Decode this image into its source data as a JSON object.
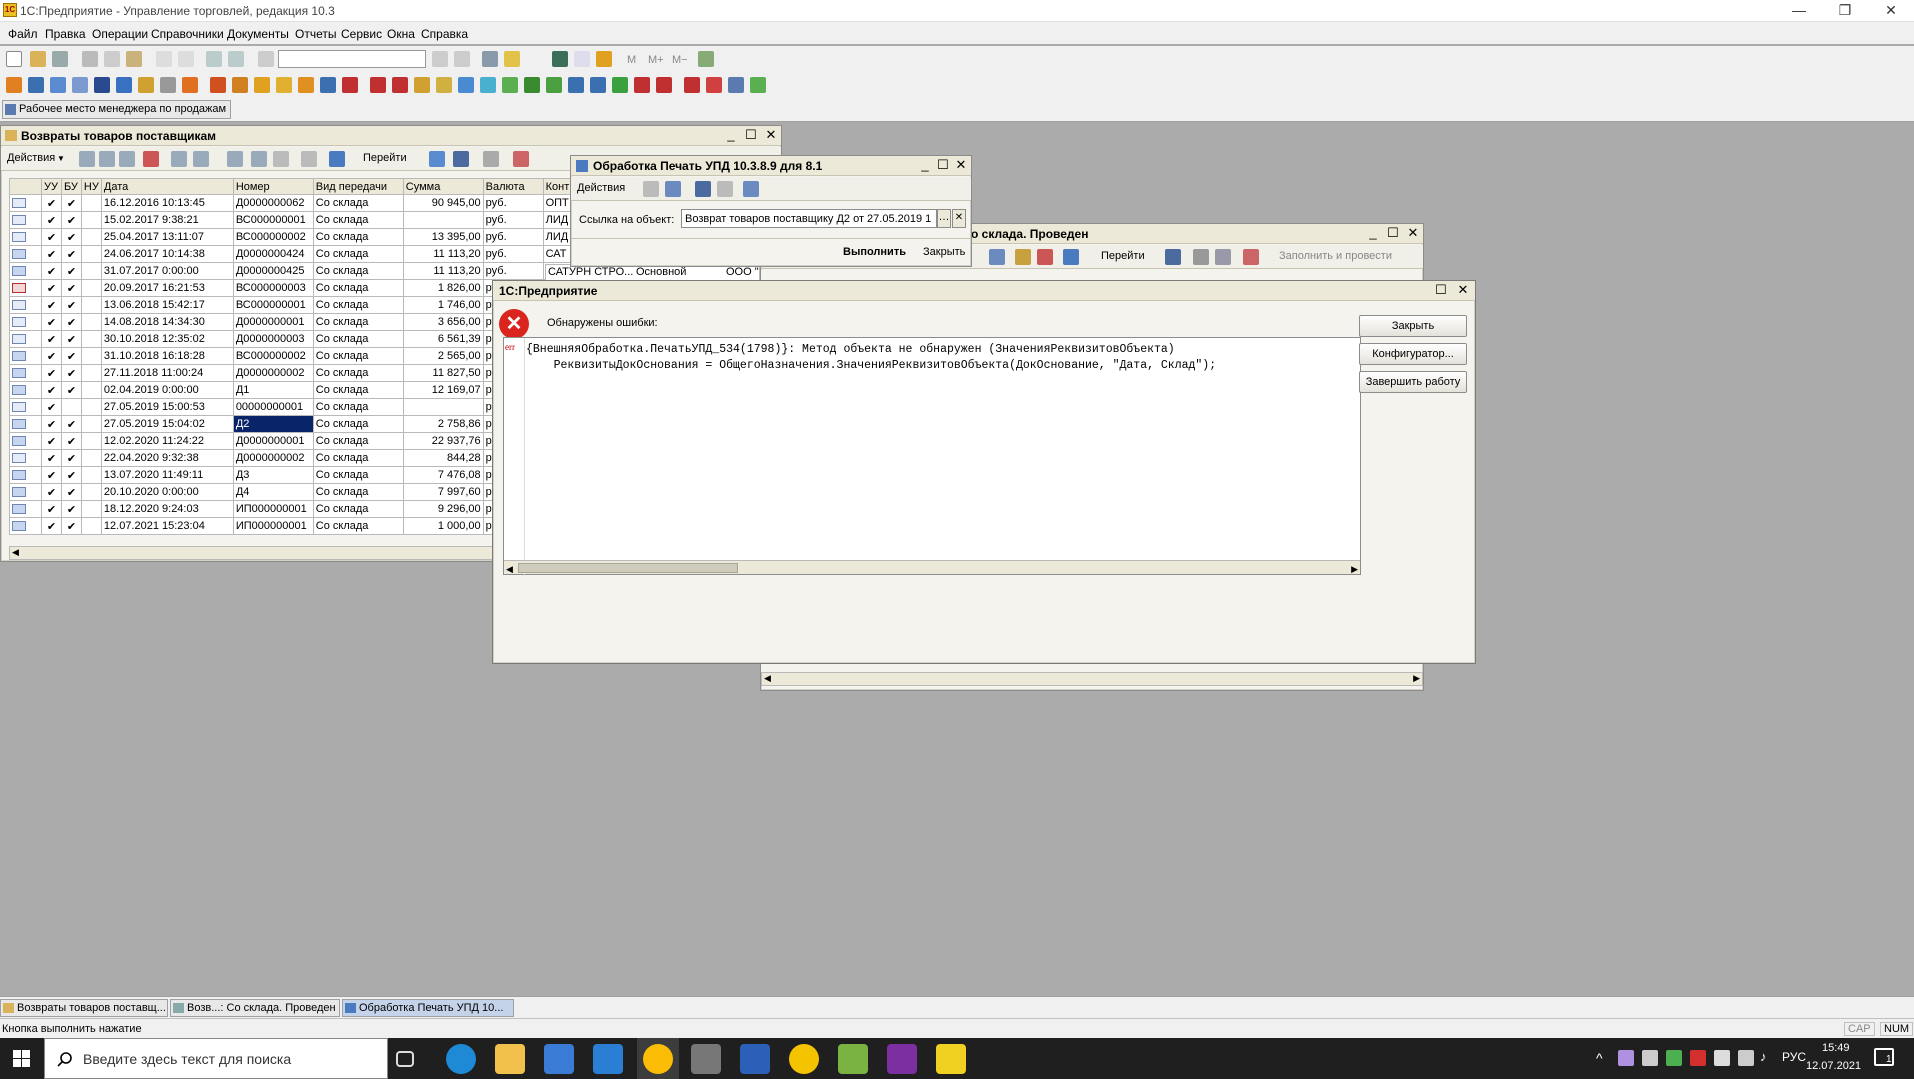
{
  "app": {
    "title": "1С:Предприятие - Управление торговлей, редакция 10.3",
    "icon_label": "1С"
  },
  "window_controls": {
    "minimize": "—",
    "restore": "❐",
    "close": "✕"
  },
  "menu": [
    "Файл",
    "Правка",
    "Операции",
    "Справочники",
    "Документы",
    "Отчеты",
    "Сервис",
    "Окна",
    "Справка"
  ],
  "quickbar": {
    "label": "Рабочее место менеджера по продажам"
  },
  "toolbar_letters": {
    "m": "M",
    "mplus": "M+",
    "mminus": "M−"
  },
  "returns_window": {
    "title": "Возвраты товаров поставщикам",
    "actions_label": "Действия",
    "goto_label": "Перейти",
    "columns": [
      "",
      "УУ",
      "БУ",
      "НУ",
      "Дата",
      "Номер",
      "Вид передачи",
      "Сумма",
      "Валюта",
      "Конт"
    ],
    "rows": [
      {
        "icon": "doc",
        "uu": "✔",
        "bu": "✔",
        "nu": "",
        "date": "16.12.2016 10:13:45",
        "num": "Д0000000062",
        "type": "Со склада",
        "sum": "90 945,00",
        "cur": "руб.",
        "kont": "ОПТ"
      },
      {
        "icon": "doc",
        "uu": "✔",
        "bu": "✔",
        "nu": "",
        "date": "15.02.2017 9:38:21",
        "num": "ВС000000001",
        "type": "Со склада",
        "sum": "",
        "cur": "руб.",
        "kont": "ЛИД"
      },
      {
        "icon": "doc",
        "uu": "✔",
        "bu": "✔",
        "nu": "",
        "date": "25.04.2017 13:11:07",
        "num": "ВС000000002",
        "type": "Со склада",
        "sum": "13 395,00",
        "cur": "руб.",
        "kont": "ЛИД"
      },
      {
        "icon": "blue",
        "uu": "✔",
        "bu": "✔",
        "nu": "",
        "date": "24.06.2017 10:14:38",
        "num": "Д0000000424",
        "type": "Со склада",
        "sum": "11 113,20",
        "cur": "руб.",
        "kont": "САТ"
      },
      {
        "icon": "blue",
        "uu": "✔",
        "bu": "✔",
        "nu": "",
        "date": "31.07.2017 0:00:00",
        "num": "Д0000000425",
        "type": "Со склада",
        "sum": "11 113,20",
        "cur": "руб.",
        "kont": "САТ"
      },
      {
        "icon": "red",
        "uu": "✔",
        "bu": "✔",
        "nu": "",
        "date": "20.09.2017 16:21:53",
        "num": "ВС000000003",
        "type": "Со склада",
        "sum": "1 826,00",
        "cur": "руб.",
        "kont": ""
      },
      {
        "icon": "doc",
        "uu": "✔",
        "bu": "✔",
        "nu": "",
        "date": "13.06.2018 15:42:17",
        "num": "ВС000000001",
        "type": "Со склада",
        "sum": "1 746,00",
        "cur": "руб.",
        "kont": ""
      },
      {
        "icon": "doc",
        "uu": "✔",
        "bu": "✔",
        "nu": "",
        "date": "14.08.2018 14:34:30",
        "num": "Д0000000001",
        "type": "Со склада",
        "sum": "3 656,00",
        "cur": "руб.",
        "kont": ""
      },
      {
        "icon": "doc",
        "uu": "✔",
        "bu": "✔",
        "nu": "",
        "date": "30.10.2018 12:35:02",
        "num": "Д0000000003",
        "type": "Со склада",
        "sum": "6 561,39",
        "cur": "р",
        "kont": ""
      },
      {
        "icon": "blue",
        "uu": "✔",
        "bu": "✔",
        "nu": "",
        "date": "31.10.2018 16:18:28",
        "num": "ВС000000002",
        "type": "Со склада",
        "sum": "2 565,00",
        "cur": "р",
        "kont": ""
      },
      {
        "icon": "blue",
        "uu": "✔",
        "bu": "✔",
        "nu": "",
        "date": "27.11.2018 11:00:24",
        "num": "Д0000000002",
        "type": "Со склада",
        "sum": "11 827,50",
        "cur": "р",
        "kont": ""
      },
      {
        "icon": "blue",
        "uu": "✔",
        "bu": "✔",
        "nu": "",
        "date": "02.04.2019 0:00:00",
        "num": "Д1",
        "type": "Со склада",
        "sum": "12 169,07",
        "cur": "р",
        "kont": ""
      },
      {
        "icon": "doc",
        "uu": "✔",
        "bu": "",
        "nu": "",
        "date": "27.05.2019 15:00:53",
        "num": "00000000001",
        "type": "Со склада",
        "sum": "",
        "cur": "р",
        "kont": ""
      },
      {
        "icon": "blue",
        "uu": "✔",
        "bu": "✔",
        "nu": "",
        "date": "27.05.2019 15:04:02",
        "num": "Д2",
        "type": "Со склада",
        "sum": "2 758,86",
        "cur": "р",
        "kont": "",
        "selected": true
      },
      {
        "icon": "blue",
        "uu": "✔",
        "bu": "✔",
        "nu": "",
        "date": "12.02.2020 11:24:22",
        "num": "Д0000000001",
        "type": "Со склада",
        "sum": "22 937,76",
        "cur": "р",
        "kont": ""
      },
      {
        "icon": "doc",
        "uu": "✔",
        "bu": "✔",
        "nu": "",
        "date": "22.04.2020 9:32:38",
        "num": "Д0000000002",
        "type": "Со склада",
        "sum": "844,28",
        "cur": "р",
        "kont": ""
      },
      {
        "icon": "blue",
        "uu": "✔",
        "bu": "✔",
        "nu": "",
        "date": "13.07.2020 11:49:11",
        "num": "Д3",
        "type": "Со склада",
        "sum": "7 476,08",
        "cur": "р",
        "kont": ""
      },
      {
        "icon": "blue",
        "uu": "✔",
        "bu": "✔",
        "nu": "",
        "date": "20.10.2020 0:00:00",
        "num": "Д4",
        "type": "Со склада",
        "sum": "7 997,60",
        "cur": "р",
        "kont": ""
      },
      {
        "icon": "blue",
        "uu": "✔",
        "bu": "✔",
        "nu": "",
        "date": "18.12.2020 9:24:03",
        "num": "ИП000000001",
        "type": "Со склада",
        "sum": "9 296,00",
        "cur": "р",
        "kont": ""
      },
      {
        "icon": "blue",
        "uu": "✔",
        "bu": "✔",
        "nu": "",
        "date": "12.07.2021 15:23:04",
        "num": "ИП000000001",
        "type": "Со склада",
        "sum": "1 000,00",
        "cur": "р",
        "kont": ""
      }
    ]
  },
  "upd_window": {
    "title": "Обработка  Печать УПД 10.3.8.9 для 8.1",
    "actions_label": "Действия",
    "link_label": "Ссылка на объект:",
    "link_value": "Возврат товаров поставщику Д2 от 27.05.2019 1",
    "run_label": "Выполнить",
    "close_label": "Закрыть"
  },
  "doc_window": {
    "title": "о склада. Проведен",
    "goto_label": "Перейти",
    "fill_label": "Заполнить и провести",
    "row_kont": "САТУРН СТРО...",
    "row_main": "Основной",
    "row_org": "ООО \""
  },
  "error_dialog": {
    "title": "1С:Предприятие",
    "message": "Обнаружены ошибки:",
    "err_tag": "err",
    "line1": "{ВнешняяОбработка.ПечатьУПД_534(1798)}: Метод объекта не обнаружен (ЗначенияРеквизитовОбъекта)",
    "line2": "    РеквизитыДокОснования = ОбщегоНазначения.ЗначенияРеквизитовОбъекта(ДокОснование, \"Дата, Склад\");",
    "close_btn": "Закрыть",
    "config_btn": "Конфигуратор...",
    "finish_btn": "Завершить работу"
  },
  "mdi_tabs": [
    "Возвраты товаров поставщ...",
    "Возв...: Со склада. Проведен",
    "Обработка  Печать УПД 10..."
  ],
  "status": {
    "text": "Кнопка выполнить нажатие",
    "cap": "CAP",
    "num": "NUM"
  },
  "taskbar": {
    "search_placeholder": "Введите здесь текст для поиска",
    "lang": "РУС",
    "time": "15:49",
    "date": "12.07.2021",
    "notif_count": "1"
  }
}
